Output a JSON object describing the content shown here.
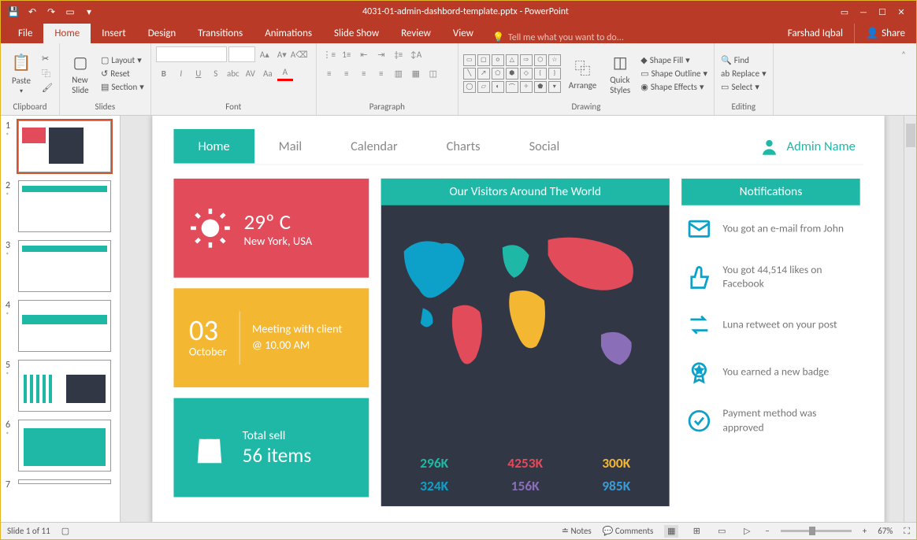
{
  "window": {
    "title": "4031-01-admin-dashbord-template.pptx - PowerPoint",
    "user": "Farshad Iqbal",
    "share": "Share"
  },
  "tabs": {
    "file": "File",
    "home": "Home",
    "insert": "Insert",
    "design": "Design",
    "transitions": "Transitions",
    "animations": "Animations",
    "slideshow": "Slide Show",
    "review": "Review",
    "view": "View",
    "tell": "Tell me what you want to do..."
  },
  "ribbon": {
    "clipboard": {
      "label": "Clipboard",
      "paste": "Paste",
      "cut": "Cut",
      "copy": "Copy",
      "format": "Format Painter"
    },
    "slides": {
      "label": "Slides",
      "new": "New\nSlide",
      "layout": "Layout",
      "reset": "Reset",
      "section": "Section"
    },
    "font": {
      "label": "Font"
    },
    "paragraph": {
      "label": "Paragraph"
    },
    "drawing": {
      "label": "Drawing",
      "arrange": "Arrange",
      "quick": "Quick\nStyles",
      "fill": "Shape Fill",
      "outline": "Shape Outline",
      "effects": "Shape Effects"
    },
    "editing": {
      "label": "Editing",
      "find": "Find",
      "replace": "Replace",
      "select": "Select"
    }
  },
  "thumbs": {
    "count": 11,
    "current": 1
  },
  "slide": {
    "nav": {
      "home": "Home",
      "mail": "Mail",
      "calendar": "Calendar",
      "charts": "Charts",
      "social": "Social"
    },
    "admin": "Admin Name",
    "weather": {
      "temp": "29º C",
      "loc": "New York, USA"
    },
    "event": {
      "day": "03",
      "month": "October",
      "text": "Meeting with client @ 10.00 AM"
    },
    "sell": {
      "label": "Total sell",
      "value": "56 items"
    },
    "map": {
      "title": "Our Visitors Around The World"
    },
    "stats": {
      "s1": "296K",
      "s2": "4253K",
      "s3": "300K",
      "s4": "324K",
      "s5": "156K",
      "s6": "985K"
    },
    "notif": {
      "title": "Notifications",
      "n1": "You got an e-mail from John",
      "n2": "You got 44,514 likes on Facebook",
      "n3": "Luna retweet on your post",
      "n4": "You earned a new badge",
      "n5": "Payment method was approved"
    }
  },
  "status": {
    "slide": "Slide 1 of 11",
    "notes": "Notes",
    "comments": "Comments",
    "zoom": "67%"
  },
  "colors": {
    "teal": "#1fb8a6",
    "red": "#e14b5a",
    "yellow": "#f4b731",
    "dark": "#323746"
  }
}
